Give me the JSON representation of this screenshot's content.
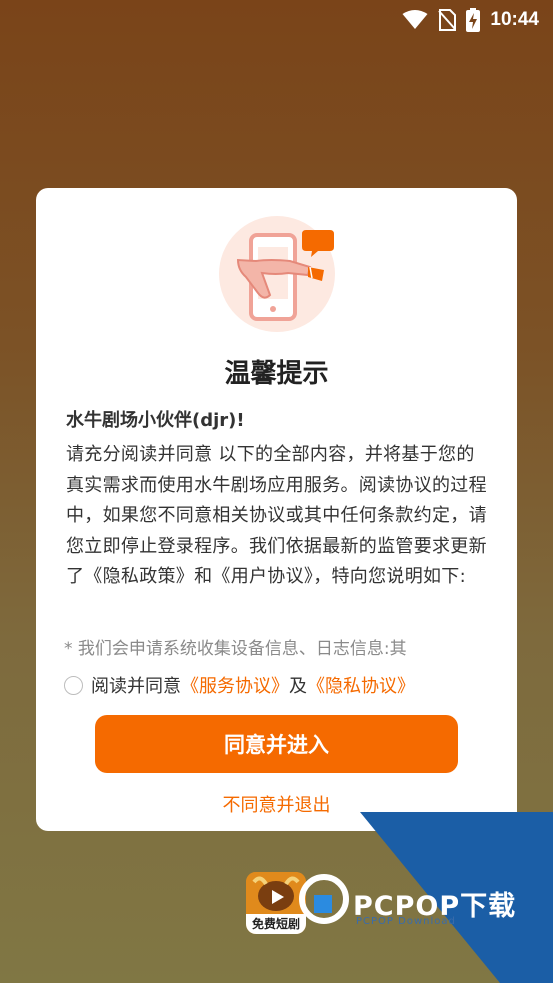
{
  "status_bar": {
    "time": "10:44"
  },
  "dialog": {
    "title": "温馨提示",
    "greeting": "水牛剧场小伙伴(djr)!",
    "body": "请充分阅读并同意 以下的全部内容，并将基于您的真实需求而使用水牛剧场应用服务。阅读协议的过程中，如果您不同意相关协议或其中任何条款约定，请您立即停止登录程序。我们依据最新的监管要求更新了《隐私政策》和《用户协议》，特向您说明如下:",
    "note": "* 我们会申请系统收集设备信息、日志信息:其",
    "agree_prefix": "阅读并同意",
    "service_link": "《服务协议》",
    "conjunction": "及",
    "privacy_link": "《隐私协议》",
    "agree_button": "同意并进入",
    "decline_button": "不同意并退出"
  },
  "app_icon": {
    "label": "免费短剧"
  },
  "watermark": {
    "text": "PCPOP下载",
    "sub": "PCPOP Download"
  },
  "colors": {
    "accent": "#f56a00",
    "watermark_blue": "#1b5ea6"
  }
}
